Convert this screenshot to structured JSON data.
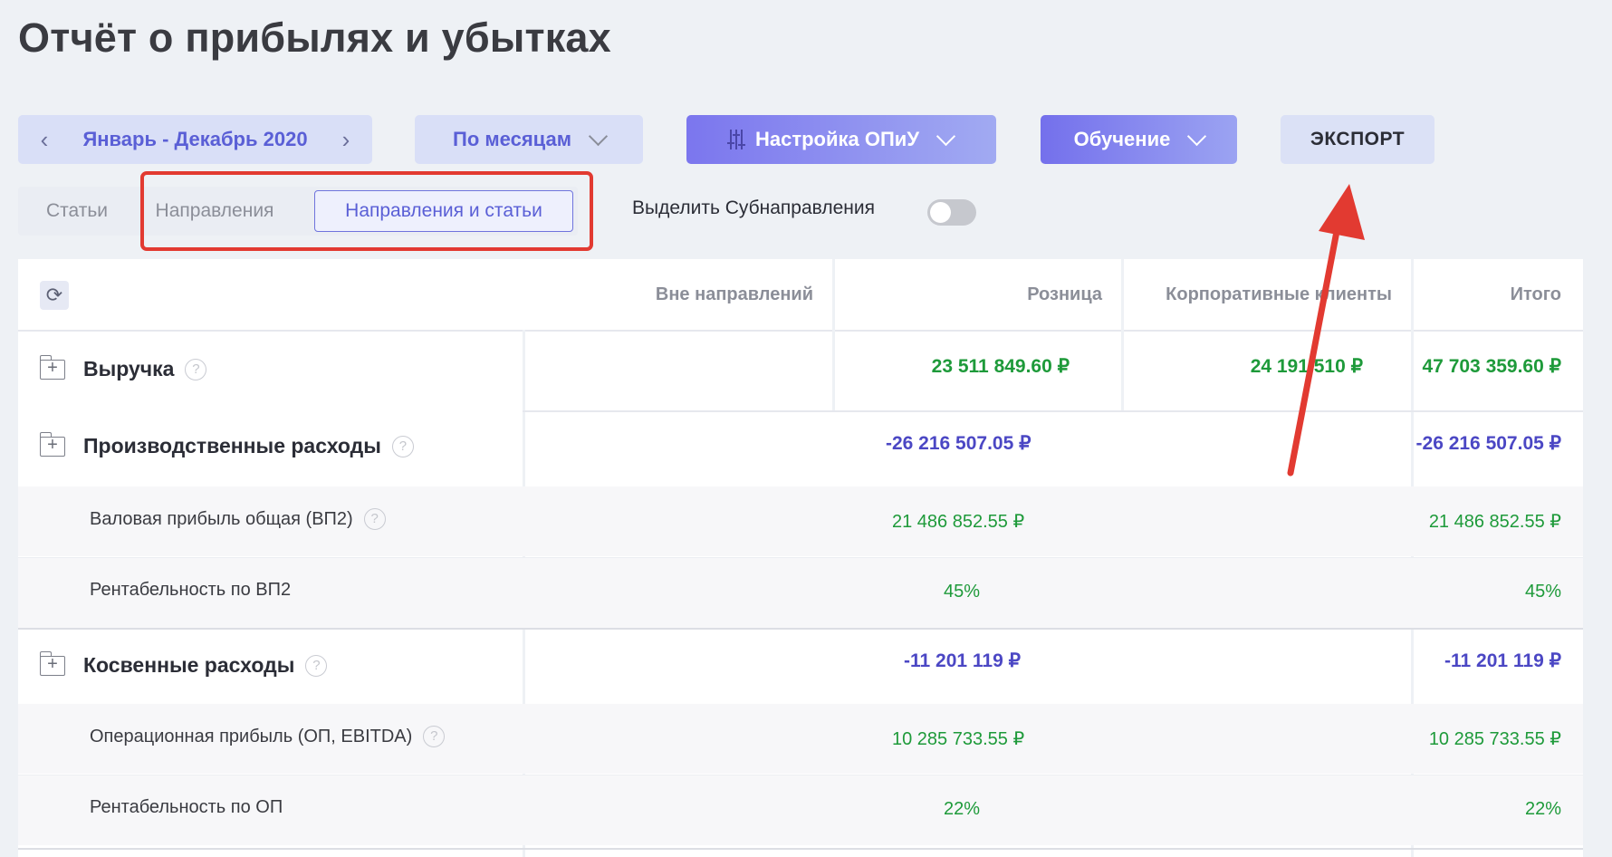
{
  "page": {
    "title": "Отчёт о прибылях и убытках"
  },
  "toolbar": {
    "period": "Январь - Декабрь 2020",
    "prev_symbol": "‹",
    "next_symbol": "›",
    "grouping": "По месяцам",
    "settings": "Настройка ОПиУ",
    "learning": "Обучение",
    "export": "ЭКСПОРТ"
  },
  "view_tabs": {
    "items": [
      "Статьи",
      "Направления",
      "Направления и статьи"
    ],
    "active_index": 2
  },
  "toggle": {
    "label": "Выделить Субнаправления",
    "on": false
  },
  "table": {
    "refresh_symbol": "⟳",
    "columns": [
      "Вне направлений",
      "Розница",
      "Корпоративные клиенты",
      "Итого"
    ],
    "rows": [
      {
        "label": "Выручка",
        "type": "group",
        "values": [
          "",
          "23 511 849.60 ₽",
          "24 191 510 ₽",
          "47 703 359.60 ₽"
        ],
        "color": "green"
      },
      {
        "label": "Производственные расходы",
        "type": "group",
        "merged_value": "-26 216 507.05 ₽",
        "total": "-26 216 507.05 ₽",
        "color": "blue"
      },
      {
        "label": "Валовая прибыль общая (ВП2)",
        "type": "sub",
        "help": true,
        "merged_value": "21 486 852.55 ₽",
        "total": "21 486 852.55 ₽",
        "color": "green"
      },
      {
        "label": "Рентабельность по ВП2",
        "type": "sub",
        "help": false,
        "merged_value": "45%",
        "total": "45%",
        "color": "green"
      },
      {
        "label": "Косвенные расходы",
        "type": "group",
        "merged_value": "-11 201 119 ₽",
        "total": "-11 201 119 ₽",
        "color": "blue"
      },
      {
        "label": "Операционная прибыль (ОП, EBITDA)",
        "type": "sub",
        "help": true,
        "merged_value": "10 285 733.55 ₽",
        "total": "10 285 733.55 ₽",
        "color": "green"
      },
      {
        "label": "Рентабельность по ОП",
        "type": "sub",
        "help": false,
        "merged_value": "22%",
        "total": "22%",
        "color": "green"
      }
    ]
  },
  "annotations": {
    "highlight_color": "#e23a31"
  },
  "colors": {
    "accent": "#5a5fd6",
    "positive": "#1e9a3a",
    "negative": "#4b47c4"
  }
}
